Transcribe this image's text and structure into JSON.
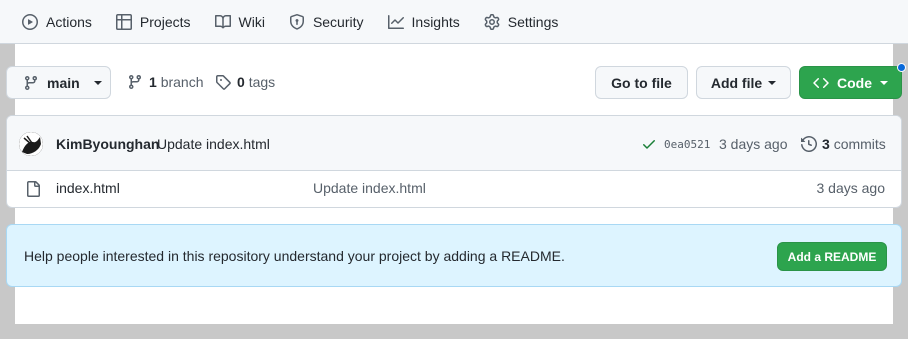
{
  "nav": {
    "items": [
      {
        "label": "Actions",
        "icon": "play-icon"
      },
      {
        "label": "Projects",
        "icon": "table-icon"
      },
      {
        "label": "Wiki",
        "icon": "book-icon"
      },
      {
        "label": "Security",
        "icon": "shield-icon"
      },
      {
        "label": "Insights",
        "icon": "graph-icon"
      },
      {
        "label": "Settings",
        "icon": "gear-icon"
      }
    ]
  },
  "toolbar": {
    "branch_name": "main",
    "branch_count": "1",
    "branch_word": "branch",
    "tag_count": "0",
    "tag_word": "tags",
    "go_to_file": "Go to file",
    "add_file": "Add file",
    "code": "Code"
  },
  "latest_commit": {
    "author": "KimByounghan",
    "message": "Update index.html",
    "sha": "0ea0521",
    "time": "3 days ago",
    "commit_count": "3",
    "commit_word": "commits"
  },
  "files": [
    {
      "name": "index.html",
      "message": "Update index.html",
      "time": "3 days ago"
    }
  ],
  "readme": {
    "text": "Help people interested in this repository understand your project by adding a README.",
    "button": "Add a README"
  },
  "colors": {
    "accent_green": "#2da44e",
    "notification_blue": "#0969da",
    "readme_bg": "#ddf4ff"
  }
}
